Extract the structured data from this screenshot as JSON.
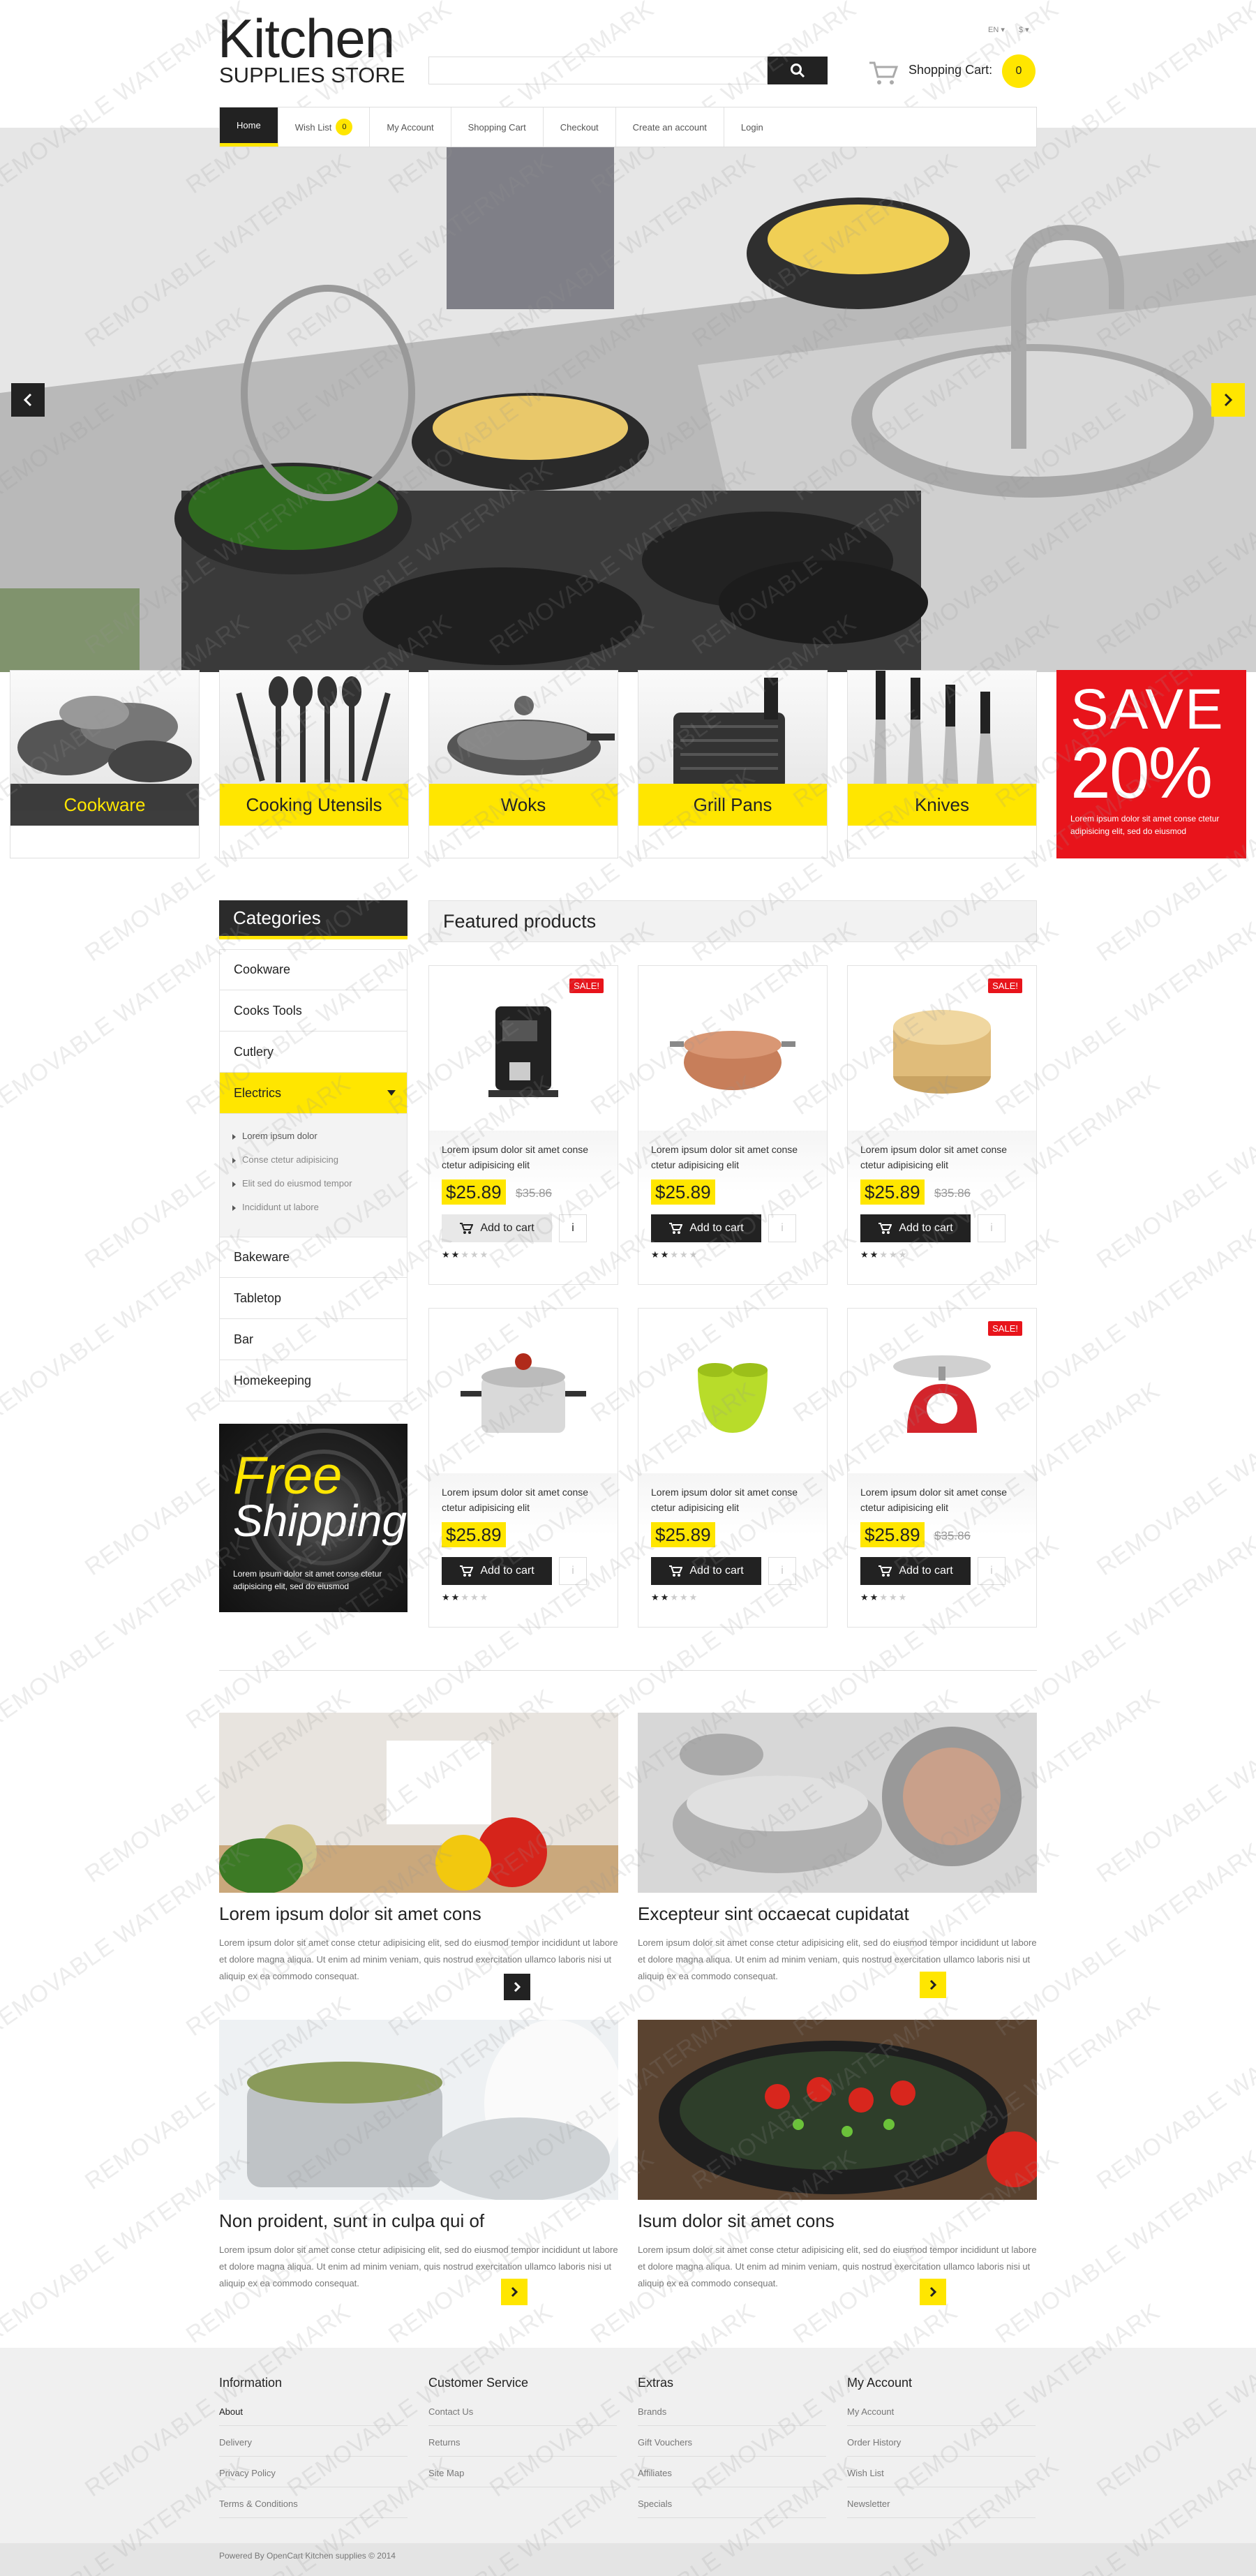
{
  "header": {
    "logo_main": "Kitchen",
    "logo_sub": "SUPPLIES STORE",
    "lang": "EN",
    "currency": "$",
    "search_placeholder": "",
    "cart_label": "Shopping Cart:",
    "cart_count": "0"
  },
  "nav": {
    "items": [
      "Home",
      "Wish List",
      "My Account",
      "Shopping Cart",
      "Checkout",
      "Create an account",
      "Login"
    ],
    "wish_count": "0"
  },
  "categories_tiles": [
    {
      "label": "Cookware"
    },
    {
      "label": "Cooking Utensils"
    },
    {
      "label": "Woks"
    },
    {
      "label": "Grill Pans"
    },
    {
      "label": "Knives"
    }
  ],
  "promo": {
    "title": "SAVE",
    "percent": "20%",
    "text": "Lorem ipsum dolor sit amet conse ctetur adipisicing elit, sed do eiusmod"
  },
  "sidebar": {
    "heading": "Categories",
    "items": [
      "Cookware",
      "Cooks Tools",
      "Cutlery",
      "Electrics",
      "Bakeware",
      "Tabletop",
      "Bar",
      "Homekeeping"
    ],
    "subitems": [
      "Lorem ipsum dolor",
      "Conse ctetur adipisicing",
      "Elit sed do eiusmod tempor",
      "Incididunt ut labore"
    ],
    "banner_title_1": "Free",
    "banner_title_2": "Shipping",
    "banner_text": "Lorem ipsum dolor sit amet conse ctetur adipisicing elit, sed do eiusmod"
  },
  "featured": {
    "heading": "Featured products",
    "sale_label": "SALE!",
    "add_label": "Add to cart",
    "products": [
      {
        "name": "Lorem ipsum dolor sit amet conse ctetur adipisicing elit",
        "price": "$25.89",
        "old_price": "$35.86",
        "sale": true,
        "icon": "coffee-machine"
      },
      {
        "name": "Lorem ipsum dolor sit amet conse ctetur adipisicing elit",
        "price": "$25.89",
        "old_price": "",
        "sale": false,
        "icon": "copper-pot"
      },
      {
        "name": "Lorem ipsum dolor sit amet conse ctetur adipisicing elit",
        "price": "$25.89",
        "old_price": "$35.86",
        "sale": true,
        "icon": "bamboo-steamer"
      },
      {
        "name": "Lorem ipsum dolor sit amet conse ctetur adipisicing elit",
        "price": "$25.89",
        "old_price": "",
        "sale": false,
        "icon": "pressure-cooker"
      },
      {
        "name": "Lorem ipsum dolor sit amet conse ctetur adipisicing elit",
        "price": "$25.89",
        "old_price": "",
        "sale": false,
        "icon": "sink-caddy"
      },
      {
        "name": "Lorem ipsum dolor sit amet conse ctetur adipisicing elit",
        "price": "$25.89",
        "old_price": "$35.86",
        "sale": true,
        "icon": "kitchen-scale"
      }
    ]
  },
  "blog": {
    "posts": [
      {
        "title": "Lorem ipsum dolor sit amet cons",
        "text": "Lorem ipsum dolor sit amet conse ctetur adipisicing elit, sed do eiusmod tempor incididunt ut labore et dolore magna aliqua. Ut enim ad minim veniam, quis nostrud exercitation ullamco laboris nisi ut aliquip ex ea commodo consequat."
      },
      {
        "title": "Excepteur sint occaecat cupidatat",
        "text": "Lorem ipsum dolor sit amet conse ctetur adipisicing elit, sed do eiusmod tempor incididunt ut labore et dolore magna aliqua. Ut enim ad minim veniam, quis nostrud exercitation ullamco laboris nisi ut aliquip ex ea commodo consequat."
      },
      {
        "title": "Non proident, sunt in culpa qui of",
        "text": "Lorem ipsum dolor sit amet conse ctetur adipisicing elit, sed do eiusmod tempor incididunt ut labore et dolore magna aliqua. Ut enim ad minim veniam, quis nostrud exercitation ullamco laboris nisi ut aliquip ex ea commodo consequat."
      },
      {
        "title": "Isum dolor sit amet cons",
        "text": "Lorem ipsum dolor sit amet conse ctetur adipisicing elit, sed do eiusmod tempor incididunt ut labore et dolore magna aliqua. Ut enim ad minim veniam, quis nostrud exercitation ullamco laboris nisi ut aliquip ex ea commodo consequat."
      }
    ]
  },
  "footer": {
    "columns": [
      {
        "title": "Information",
        "links": [
          "About",
          "Delivery",
          "Privacy Policy",
          "Terms & Conditions"
        ]
      },
      {
        "title": "Customer Service",
        "links": [
          "Contact Us",
          "Returns",
          "Site Map"
        ]
      },
      {
        "title": "Extras",
        "links": [
          "Brands",
          "Gift Vouchers",
          "Affiliates",
          "Specials"
        ]
      },
      {
        "title": "My Account",
        "links": [
          "My Account",
          "Order History",
          "Wish List",
          "Newsletter"
        ]
      }
    ],
    "copyright": "Powered By OpenCart Kitchen supplies © 2014"
  },
  "watermark": "REMOVABLE WATERMARK",
  "colors": {
    "accent": "#ffe600",
    "dark": "#222222",
    "sale": "#e8141b"
  }
}
